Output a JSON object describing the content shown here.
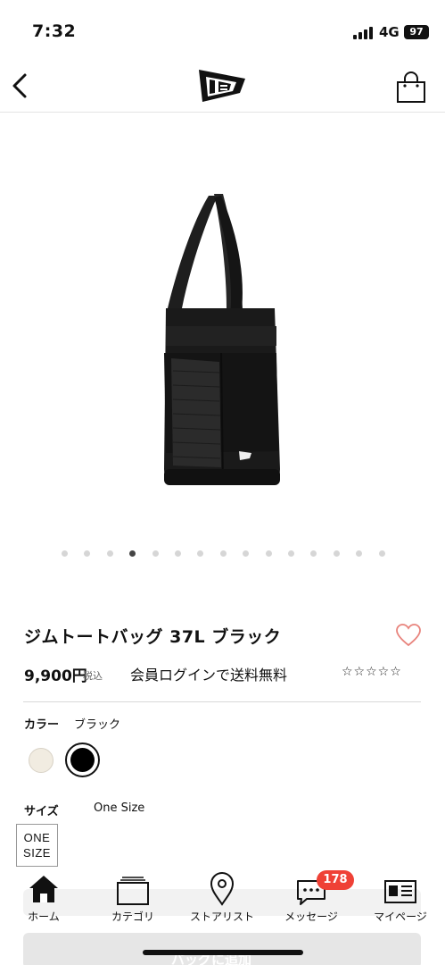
{
  "status_bar": {
    "time": "7:32",
    "network": "4G",
    "battery": "97"
  },
  "product": {
    "title": "ジムトートバッグ 37L ブラック",
    "price": "9,900円",
    "tax_note": "税込",
    "shipping_note": "会員ログインで送料無料",
    "rating_stars": "☆☆☆☆☆",
    "image_count": 15,
    "active_image_index": 3
  },
  "color": {
    "label": "カラー",
    "value": "ブラック",
    "options": [
      "cream",
      "black"
    ],
    "selected": "black"
  },
  "size": {
    "label": "サイズ",
    "value": "One Size",
    "option_line1": "ONE",
    "option_line2": "SIZE"
  },
  "add_to_bag": {
    "label": "バッグに追加"
  },
  "tabbar": {
    "home": "ホーム",
    "category": "カテゴリ",
    "store": "ストアリスト",
    "message": "メッセージ",
    "message_badge": "178",
    "mypage": "マイページ"
  },
  "colors": {
    "badge": "#ef4136",
    "favorite": "#e8837c"
  }
}
